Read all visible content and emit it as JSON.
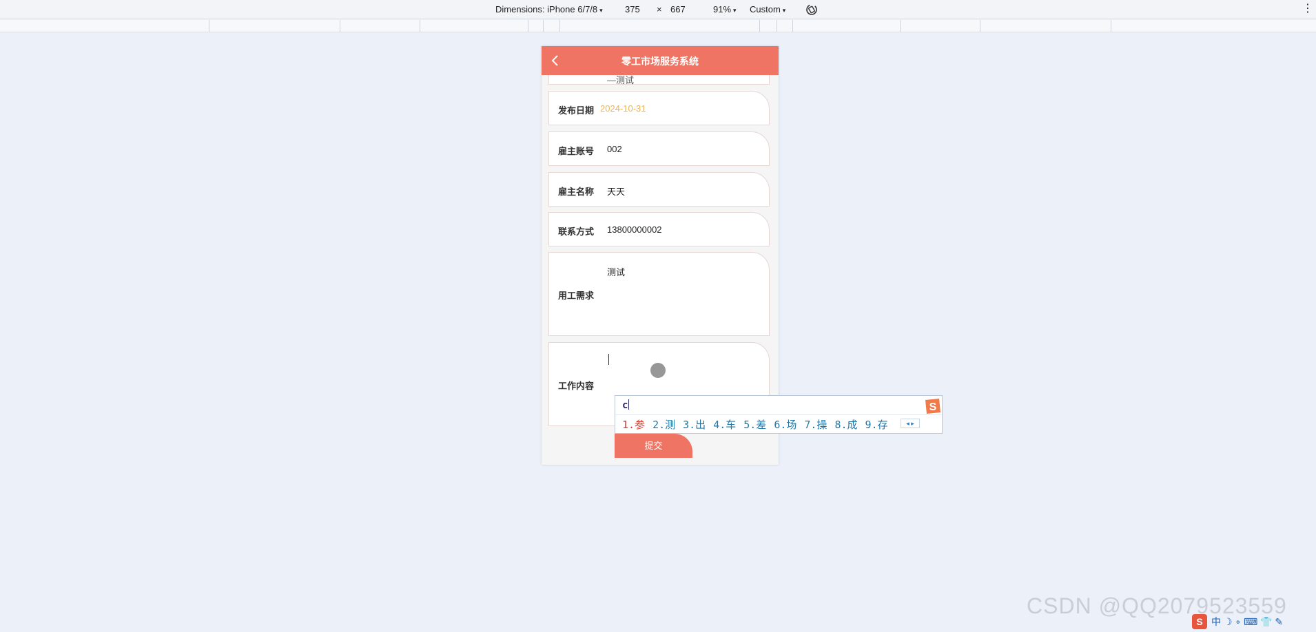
{
  "devtools": {
    "dimensions_label": "Dimensions: iPhone 6/7/8",
    "width": "375",
    "times": "×",
    "height": "667",
    "zoom": "91%",
    "throttle": "Custom",
    "caret": "▾",
    "more": "⋮"
  },
  "app": {
    "title": "零工市场服务系统",
    "partial_value": "—测试",
    "fields": {
      "publish_date": {
        "label": "发布日期",
        "value": "2024-10-31"
      },
      "employer_account": {
        "label": "雇主账号",
        "value": "002"
      },
      "employer_name": {
        "label": "雇主名称",
        "value": "天天"
      },
      "contact": {
        "label": "联系方式",
        "value": "13800000002"
      },
      "requirement": {
        "label": "用工需求",
        "value": "测试"
      },
      "job_content": {
        "label": "工作内容",
        "value": ""
      }
    },
    "submit_label": "提交"
  },
  "ime": {
    "input": "c",
    "candidates": [
      "1.参",
      "2.测",
      "3.出",
      "4.车",
      "5.差",
      "6.场",
      "7.操",
      "8.成",
      "9.存"
    ],
    "pager": "◂ ▸"
  },
  "watermark": "CSDN @QQ2079523559",
  "tray": {
    "logo": "S",
    "text": "中 ☽ ∘ ⌨ 👕 ✎"
  },
  "colors": {
    "accent": "#f07463",
    "date": "#f0b34a",
    "page_bg": "#ecf0f9"
  }
}
